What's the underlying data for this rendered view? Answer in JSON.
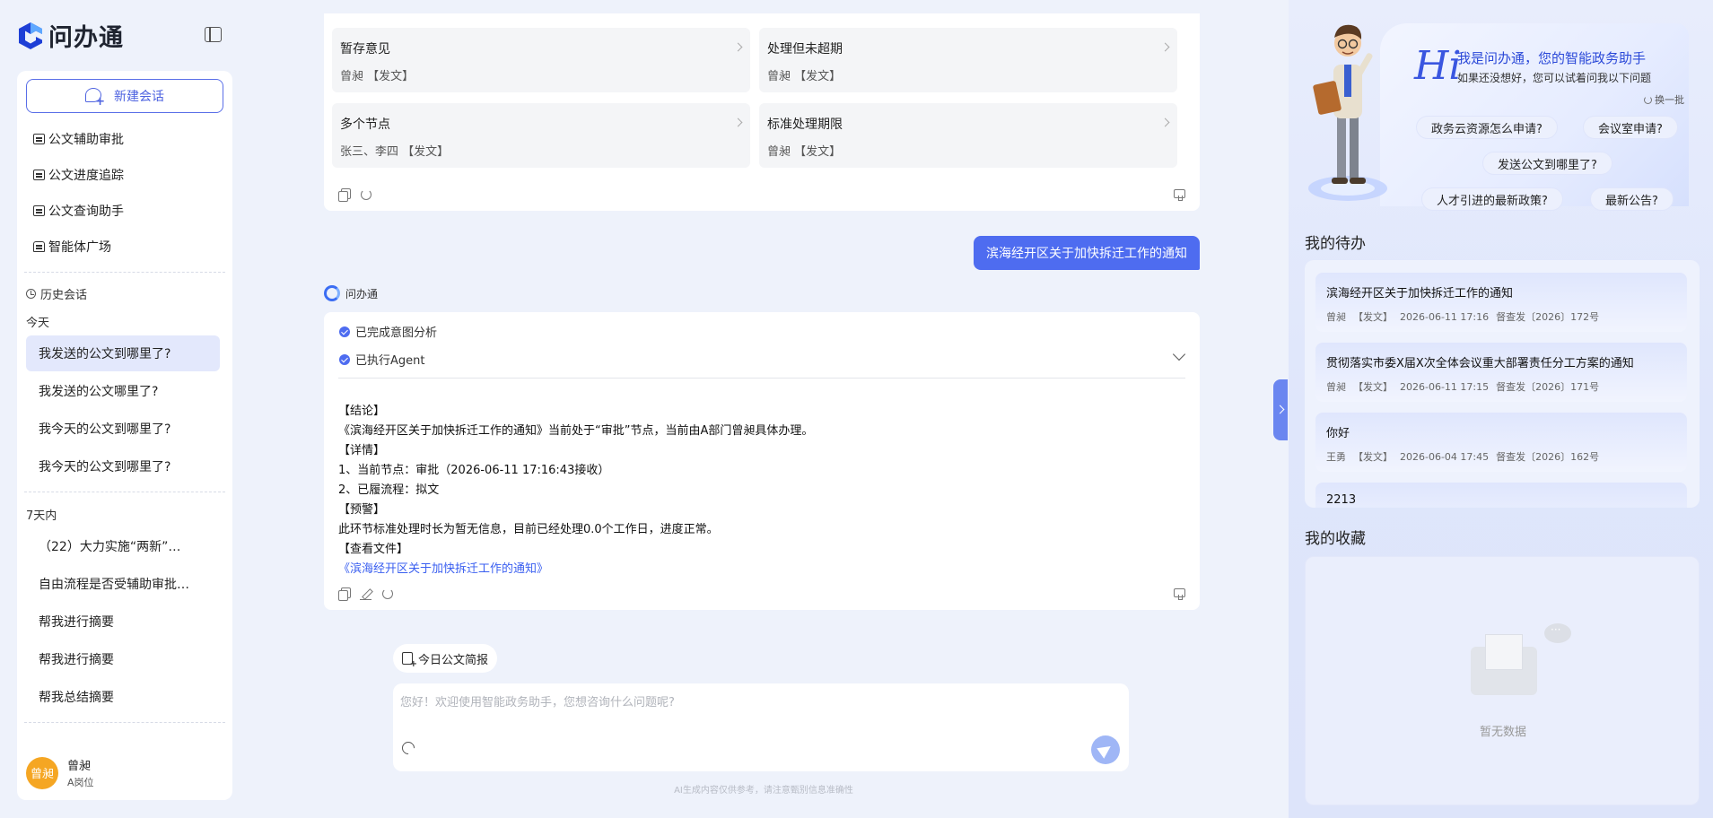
{
  "app": {
    "name": "问办通"
  },
  "sidebar": {
    "new_chat": "新建会话",
    "menu": [
      {
        "label": "公文辅助审批",
        "icon": "doc-icon"
      },
      {
        "label": "公文进度追踪",
        "icon": "doc-icon"
      },
      {
        "label": "公文查询助手",
        "icon": "doc-icon"
      },
      {
        "label": "智能体广场",
        "icon": "agent-icon"
      }
    ],
    "history_label": "历史会话",
    "groups": [
      {
        "label": "今天",
        "items": [
          "我发送的公文到哪里了?",
          "我发送的公文哪里了?",
          "我今天的公文到哪里了?",
          "我今天的公文到哪里了?"
        ]
      },
      {
        "label": "7天内",
        "items": [
          "（22）大力实施“两新”…",
          "自由流程是否受辅助审批…",
          "帮我进行摘要",
          "帮我进行摘要",
          "帮我总结摘要"
        ]
      }
    ],
    "user": {
      "avatar": "曾昶",
      "name": "曾昶",
      "role": "A岗位"
    }
  },
  "chat": {
    "options": [
      {
        "title": "暂存意见",
        "sub": "曾昶 【发文】"
      },
      {
        "title": "处理但未超期",
        "sub": "曾昶 【发文】"
      },
      {
        "title": "多个节点",
        "sub": "张三、李四 【发文】"
      },
      {
        "title": "标准处理期限",
        "sub": "曾昶 【发文】"
      }
    ],
    "user_message": "滨海经开区关于加快拆迁工作的通知",
    "bot_name": "问办通",
    "steps": [
      "已完成意图分析",
      "已执行Agent"
    ],
    "answer": [
      "【结论】",
      "《滨海经开区关于加快拆迁工作的通知》当前处于“审批”节点，当前由A部门曾昶具体办理。",
      "【详情】",
      "1、当前节点：审批（2026-06-11 17:16:43接收）",
      "2、已履流程：拟文",
      "【预警】",
      "此环节标准处理时长为暂无信息，目前已经处理0.0个工作日，进度正常。",
      "【查看文件】"
    ],
    "answer_link": "《滨海经开区关于加快拆迁工作的通知》",
    "quick_chip": "今日公文简报",
    "input_placeholder": "您好！欢迎使用智能政务助手，您想咨询什么问题呢?",
    "disclaimer": "AI生成内容仅供参考，请注意甄别信息准确性"
  },
  "right": {
    "hi": "Hi",
    "hero_title": "我是问办通，您的智能政务助手",
    "hero_sub": "如果还没想好，您可以试着问我以下问题",
    "swap": "换一批",
    "questions": [
      "政务云资源怎么申请?",
      "会议室申请?",
      "发送公文到哪里了?",
      "人才引进的最新政策?",
      "最新公告?"
    ],
    "todo_title": "我的待办",
    "todos": [
      {
        "title": "滨海经开区关于加快拆迁工作的通知",
        "person": "曾昶",
        "type": "【发文】",
        "time": "2026-06-11 17:16",
        "code": "督查发〔2026〕172号"
      },
      {
        "title": "贯彻落实市委X届X次全体会议重大部署责任分工方案的通知",
        "person": "曾昶",
        "type": "【发文】",
        "time": "2026-06-11 17:15",
        "code": "督查发〔2026〕171号"
      },
      {
        "title": "你好",
        "person": "王勇",
        "type": "【发文】",
        "time": "2026-06-04 17:45",
        "code": "督查发〔2026〕162号"
      },
      {
        "title": "2213",
        "person": "",
        "type": "",
        "time": "",
        "code": ""
      }
    ],
    "fav_title": "我的收藏",
    "empty": "暂无数据"
  },
  "colors": {
    "accent": "#4e6cf0",
    "link": "#3a5ff0",
    "avatar": "#f5a623"
  }
}
